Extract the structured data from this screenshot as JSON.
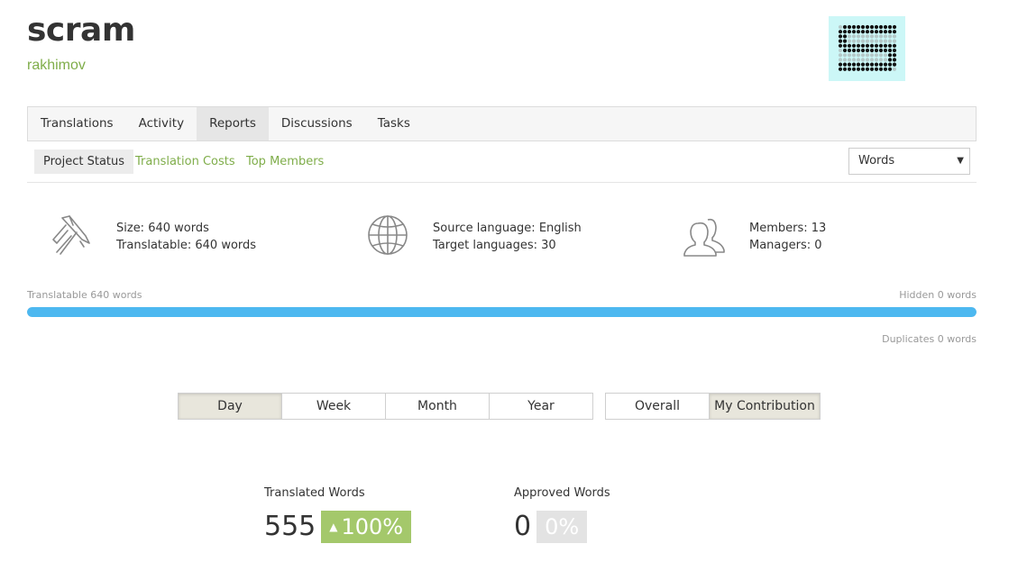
{
  "project": {
    "title": "scram",
    "owner": "rakhimov"
  },
  "tabs": [
    {
      "label": "Translations"
    },
    {
      "label": "Activity"
    },
    {
      "label": "Reports",
      "active": true
    },
    {
      "label": "Discussions"
    },
    {
      "label": "Tasks"
    }
  ],
  "subtabs": [
    {
      "label": "Project Status",
      "active": true
    },
    {
      "label": "Translation Costs"
    },
    {
      "label": "Top Members"
    }
  ],
  "unit_select": {
    "value": "Words"
  },
  "stats": {
    "size": {
      "line1": "Size: 640 words",
      "line2": "Translatable: 640 words",
      "icon": "calipers-icon"
    },
    "languages": {
      "line1": "Source language: English",
      "line2": "Target languages: 30",
      "icon": "globe-icon"
    },
    "members": {
      "line1": "Members: 13",
      "line2": "Managers: 0",
      "icon": "users-icon"
    }
  },
  "progress": {
    "translatable_label": "Translatable 640 words",
    "hidden_label": "Hidden 0 words",
    "duplicates_label": "Duplicates 0 words",
    "translatable_fraction": 1.0,
    "fill_color": "#4db8f0"
  },
  "periods": [
    {
      "label": "Day",
      "active": true
    },
    {
      "label": "Week"
    },
    {
      "label": "Month"
    },
    {
      "label": "Year"
    }
  ],
  "scope": [
    {
      "label": "Overall"
    },
    {
      "label": "My Contribution",
      "active": true
    }
  ],
  "metrics": {
    "translated": {
      "label": "Translated Words",
      "value": "555",
      "badge": "100%",
      "arrow": "▲",
      "color": "#a4c86b"
    },
    "approved": {
      "label": "Approved Words",
      "value": "0",
      "badge": "0%"
    }
  },
  "colors": {
    "accent_green": "#7fad4a",
    "logo_bg": "#ccf7f7"
  }
}
